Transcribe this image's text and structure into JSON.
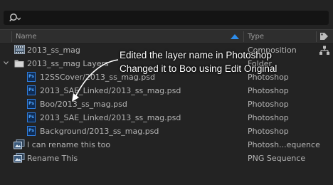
{
  "search": {
    "placeholder": ""
  },
  "header": {
    "name_label": "Name",
    "type_label": "Type"
  },
  "rows": [
    {
      "name": "2013_ss_mag",
      "type": "Composition",
      "icon": "composition-icon"
    },
    {
      "name": "2013_ss_mag Layers",
      "type": "Folder",
      "icon": "folder-icon"
    },
    {
      "name": "12SSCover/2013_ss_mag.psd",
      "type": "Photoshop",
      "icon": "photoshop-file-icon"
    },
    {
      "name": "2013_SAE_Linked/2013_ss_mag.psd",
      "type": "Photoshop",
      "icon": "photoshop-file-icon"
    },
    {
      "name": "Boo/2013_ss_mag.psd",
      "type": "Photoshop",
      "icon": "photoshop-file-icon"
    },
    {
      "name": "2013_SAE_Linked/2013_ss_mag.psd",
      "type": "Photoshop",
      "icon": "photoshop-file-icon"
    },
    {
      "name": "Background/2013_ss_mag.psd",
      "type": "Photoshop",
      "icon": "photoshop-file-icon"
    },
    {
      "name": "I can rename this too",
      "type": "Photosh...equence",
      "icon": "image-sequence-icon"
    },
    {
      "name": "Rename This",
      "type": "PNG Sequence",
      "icon": "image-sequence-icon"
    }
  ],
  "annotation": {
    "line1": "Edited the layer name in Photoshop",
    "line2": "Changed it to Boo using Edit Original"
  },
  "colors": {
    "accent": "#2d8ceb",
    "background": "#232323",
    "photoshop_blue": "#2f7ee0"
  }
}
